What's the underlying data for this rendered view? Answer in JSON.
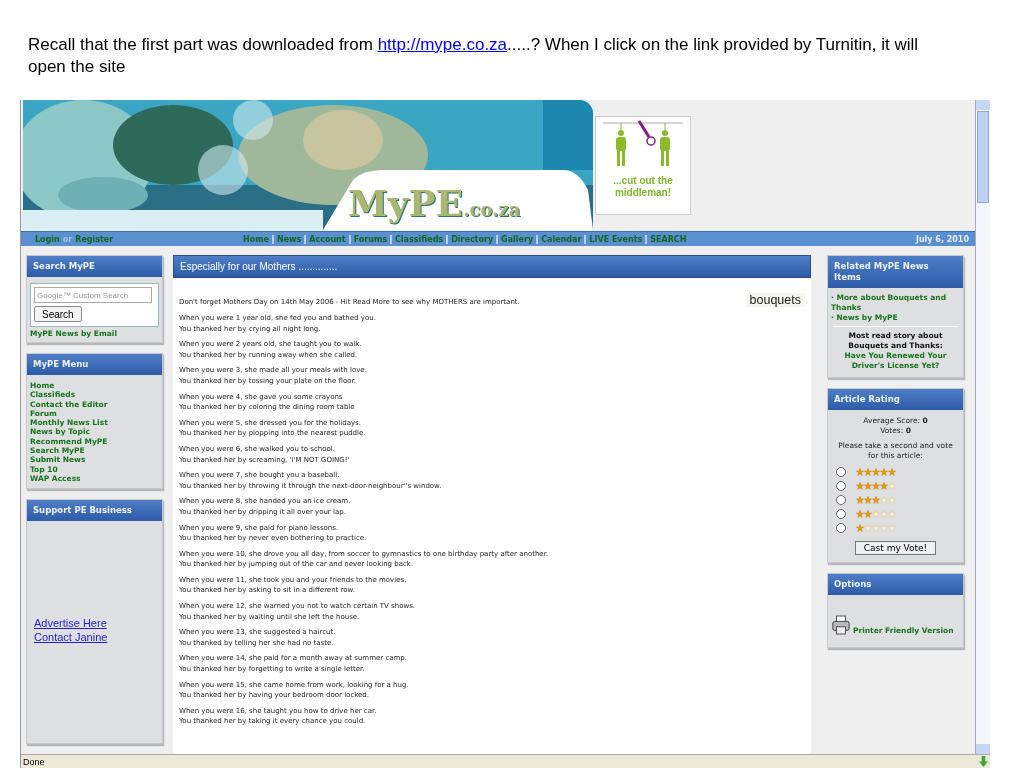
{
  "caption": {
    "before": "Recall that the first part was downloaded from ",
    "link": "http://mype.co.za",
    "after": ".....? When I click on the link provided by Turnitin, it will open the site"
  },
  "banner": {
    "logo": "MyPE",
    "logo_suffix": ".co.za",
    "ad_text": "...cut out the middleman!"
  },
  "nav": {
    "login": "Login",
    "or": "or",
    "register": "Register",
    "links": [
      "Home",
      "News",
      "Account",
      "Forums",
      "Classifieds",
      "Directory",
      "Gallery",
      "Calendar",
      "LIVE Events",
      "SEARCH"
    ],
    "date": "July 6, 2010"
  },
  "search_box": {
    "title": "Search MyPE",
    "placeholder": "Google™ Custom Search",
    "button": "Search",
    "link": "MyPE News by Email"
  },
  "menu": {
    "title": "MyPE Menu",
    "items": [
      "Home",
      "Classifieds",
      "Contact the Editor",
      "Forum",
      "Monthly News List",
      "News by Topic",
      "Recommend MyPE",
      "Search MyPE",
      "Submit News",
      "Top 10",
      "WAP Access"
    ]
  },
  "support": {
    "title": "Support PE Business",
    "links": [
      "Advertise Here",
      "Contact Janine"
    ]
  },
  "article": {
    "title": "Especially for our Mothers ..............",
    "intro": "Don't forget Mothers Day on 14th May 2006 - Hit Read More to see why MOTHERS are important.",
    "tag": "bouquets",
    "paragraphs": [
      [
        "When you were 1 year old, she fed you and bathed you.",
        "You thanked her by crying all night long."
      ],
      [
        "When you were 2 years old, she taught you to walk.",
        "You thanked her by running away when she called."
      ],
      [
        "When you were 3, she made all your meals with love.",
        "You thanked her by tossing your plate on the floor."
      ],
      [
        "When you were 4, she gave you some crayons",
        "You thanked her by coloring the dining room table"
      ],
      [
        "When you were 5, she dressed you for the holidays.",
        "You thanked her by plopping into the nearest puddle."
      ],
      [
        "When you were 6, she walked you to school.",
        "You thanked her by screaming, 'I'M NOT GOING!'"
      ],
      [
        "When you were 7, she bought you a baseball.",
        "You thanked her by throwing it through the next-door-neighbour''s window."
      ],
      [
        "When you were 8, she handed you an ice cream.",
        "You thanked her by dripping it all over your lap."
      ],
      [
        "When you were 9, she paid for piano lessons.",
        "You thanked her by never even bothering to practice."
      ],
      [
        "When you were 10, she drove you all day, from soccer to gymnastics to one birthday party after another.",
        "You thanked her by jumping out of the car and never looking back."
      ],
      [
        "When you were 11, she took you and your friends to the movies.",
        "You thanked her by asking to sit in a different row."
      ],
      [
        "When you were 12, she warned you not to watch certain TV shows.",
        "You thanked her by waiting until she left the house."
      ],
      [
        "When you were 13, she suggested a haircut.",
        "You thanked by telling her she had no taste."
      ],
      [
        "When you were 14, she paid for a month away at summer camp.",
        "You thanked her by forgetting to write a single letter."
      ],
      [
        "When you were 15, she came home from work, looking for a hug.",
        "You thanked her by having your bedroom door locked."
      ],
      [
        "When you were 16, she taught you how to drive her car.",
        "You thanked her by taking it every chance you could."
      ]
    ]
  },
  "related": {
    "title": "Related MyPE News Items",
    "items": [
      "· More about Bouquets and Thanks",
      "· News by MyPE"
    ],
    "most_read_label": "Most read story about Bouquets and Thanks:",
    "most_read_link": "Have You Renewed Your Driver's License Yet?"
  },
  "rating": {
    "title": "Article Rating",
    "score_label": "Average Score:",
    "score": "0",
    "votes_label": "Votes:",
    "votes": "0",
    "prompt": "Please take a second and vote for this article:",
    "options": [
      {
        "stars": 5,
        "selected": false
      },
      {
        "stars": 4,
        "selected": false
      },
      {
        "stars": 3,
        "selected": false
      },
      {
        "stars": 2,
        "selected": false
      },
      {
        "stars": 1,
        "selected": false
      }
    ],
    "button": "Cast my Vote!"
  },
  "options": {
    "title": "Options",
    "link": "Printer Friendly Version"
  },
  "status_bar": "Done"
}
